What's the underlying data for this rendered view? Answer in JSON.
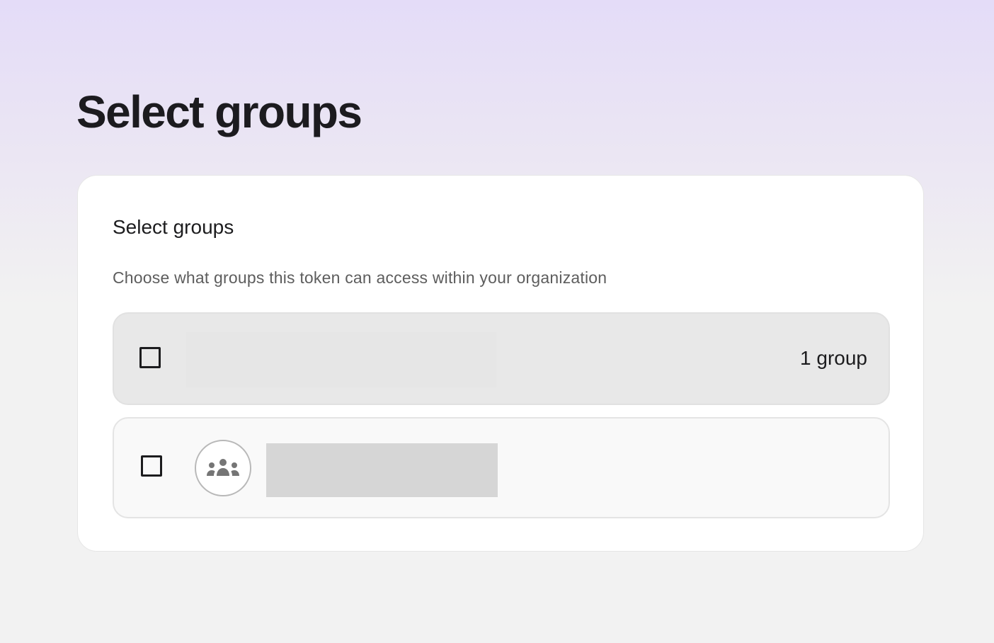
{
  "page": {
    "title": "Select groups"
  },
  "card": {
    "title": "Select groups",
    "description": "Choose what groups this token can access within your organization",
    "select_all_row": {
      "checked": false,
      "count_label": "1 group"
    },
    "groups": [
      {
        "checked": false,
        "icon": "groups-icon",
        "name": ""
      }
    ]
  },
  "colors": {
    "background_top": "#e4dcf8",
    "background_bottom": "#f2f2f2",
    "card": "#ffffff",
    "text_primary": "#1c1c1e",
    "text_secondary": "#5d5d5d",
    "row_header": "#e8e8e8",
    "row_item": "#f9f9f9",
    "icon": "#757575"
  }
}
